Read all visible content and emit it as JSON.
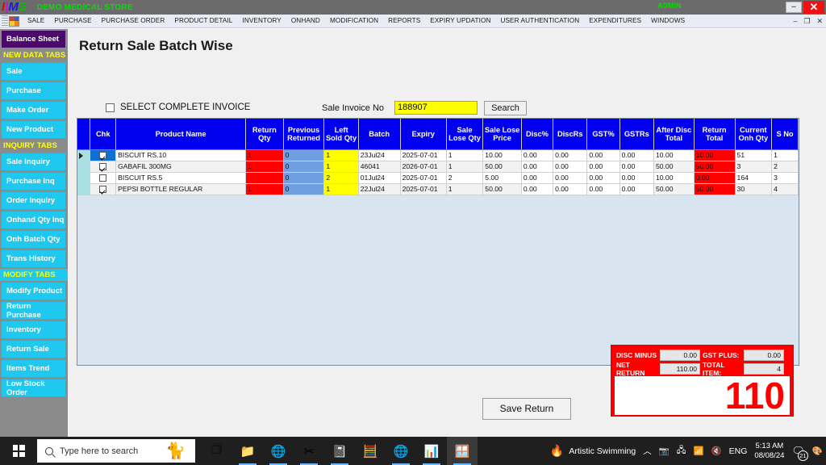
{
  "titlebar": {
    "logo_letters": [
      "I",
      "M",
      "S"
    ],
    "store_name": "DEMO MEDICAL STORE",
    "user_role": "ADMIN",
    "minimize_label": "–",
    "close_label": "✕"
  },
  "menubar": {
    "items": [
      "SALE",
      "PURCHASE",
      "PURCHASE ORDER",
      "PRODUCT DETAIL",
      "INVENTORY",
      "ONHAND",
      "MODIFICATION",
      "REPORTS",
      "EXPIRY UPDATION",
      "USER AUTHENTICATION",
      "EXPENDITURES",
      "WINDOWS"
    ],
    "mdi_minimize": "–",
    "mdi_restore": "❐",
    "mdi_close": "✕"
  },
  "sidebar": {
    "items": [
      {
        "label": "Balance Sheet",
        "type": "balance"
      },
      {
        "label": "NEW DATA TABS",
        "type": "header"
      },
      {
        "label": "Sale",
        "type": "button"
      },
      {
        "label": "Purchase",
        "type": "button"
      },
      {
        "label": "Make Order",
        "type": "button"
      },
      {
        "label": "New Product",
        "type": "button"
      },
      {
        "label": "INQUIRY TABS",
        "type": "header"
      },
      {
        "label": "Sale Inquiry",
        "type": "button"
      },
      {
        "label": "Purchase Inq",
        "type": "button"
      },
      {
        "label": "Order Inquiry",
        "type": "button"
      },
      {
        "label": "Onhand Qty Inq",
        "type": "button"
      },
      {
        "label": "Onh Batch Qty",
        "type": "button"
      },
      {
        "label": "Trans History",
        "type": "button"
      },
      {
        "label": "MODIFY TABS",
        "type": "header-modify"
      },
      {
        "label": "Modify Product",
        "type": "button"
      },
      {
        "label": "Return Purchase",
        "type": "button"
      },
      {
        "label": "Inventory",
        "type": "button"
      },
      {
        "label": "Return Sale",
        "type": "button"
      },
      {
        "label": "Items Trend",
        "type": "button"
      },
      {
        "label": "Low Stock Order",
        "type": "button"
      }
    ]
  },
  "main": {
    "page_title": "Return Sale Batch Wise",
    "select_complete_invoice_label": "SELECT COMPLETE INVOICE",
    "select_complete_invoice_checked": false,
    "invoice_label": "Sale Invoice No",
    "invoice_value": "188907",
    "search_button": "Search",
    "save_button": "Save Return"
  },
  "grid": {
    "columns": [
      "",
      "Chk",
      "Product Name",
      "Return Qty",
      "Previous Returned",
      "Left Sold Qty",
      "Batch",
      "Expiry",
      "Sale Lose Qty",
      "Sale Lose Price",
      "Disc%",
      "DiscRs",
      "GST%",
      "GSTRs",
      "After Disc Total",
      "Return Total",
      "Current Onh Qty",
      "S No"
    ],
    "rows": [
      {
        "selected": true,
        "checked": true,
        "product_name": "BISCUIT RS.10",
        "return_qty": "1",
        "previous_returned": "0",
        "left_sold_qty": "1",
        "batch": "23Jul24",
        "expiry": "2025-07-01",
        "sale_lose_qty": "1",
        "sale_lose_price": "10.00",
        "disc_pct": "0.00",
        "disc_rs": "0.00",
        "gst_pct": "0.00",
        "gst_rs": "0.00",
        "after_disc_total": "10.00",
        "return_total": "10.00",
        "current_onh_qty": "51",
        "s_no": "1"
      },
      {
        "selected": false,
        "checked": true,
        "product_name": "GABAFIL 300MG",
        "return_qty": "1",
        "previous_returned": "0",
        "left_sold_qty": "1",
        "batch": "46041",
        "expiry": "2026-07-01",
        "sale_lose_qty": "1",
        "sale_lose_price": "50.00",
        "disc_pct": "0.00",
        "disc_rs": "0.00",
        "gst_pct": "0.00",
        "gst_rs": "0.00",
        "after_disc_total": "50.00",
        "return_total": "50.00",
        "current_onh_qty": "3",
        "s_no": "2"
      },
      {
        "selected": false,
        "checked": false,
        "product_name": "BISCUIT RS.5",
        "return_qty": "",
        "previous_returned": "0",
        "left_sold_qty": "2",
        "batch": "01Jul24",
        "expiry": "2025-07-01",
        "sale_lose_qty": "2",
        "sale_lose_price": "5.00",
        "disc_pct": "0.00",
        "disc_rs": "0.00",
        "gst_pct": "0.00",
        "gst_rs": "0.00",
        "after_disc_total": "10.00",
        "return_total": "0.00",
        "current_onh_qty": "164",
        "s_no": "3"
      },
      {
        "selected": false,
        "checked": true,
        "product_name": "PEPSI BOTTLE REGULAR",
        "return_qty": "1",
        "previous_returned": "0",
        "left_sold_qty": "1",
        "batch": "22Jul24",
        "expiry": "2025-07-01",
        "sale_lose_qty": "1",
        "sale_lose_price": "50.00",
        "disc_pct": "0.00",
        "disc_rs": "0.00",
        "gst_pct": "0.00",
        "gst_rs": "0.00",
        "after_disc_total": "50.00",
        "return_total": "50.00",
        "current_onh_qty": "30",
        "s_no": "4"
      }
    ]
  },
  "totals": {
    "disc_minus_label": "DISC MINUS",
    "disc_minus_value": "0.00",
    "gst_plus_label": "GST PLUS:",
    "gst_plus_value": "0.00",
    "net_return_label": "NET RETURN",
    "net_return_value": "110.00",
    "total_item_label": "TOTAL ITEM:",
    "total_item_value": "4",
    "grand_total": "110"
  },
  "taskbar": {
    "search_placeholder": "Type here to search",
    "news_text": "Artistic Swimming",
    "language": "ENG",
    "time": "5:13 AM",
    "date": "08/08/24",
    "notification_count": "21"
  },
  "colors": {
    "header_blue": "#0000ee",
    "sidebar_cyan": "#1ec8ef",
    "balance_purple": "#4b0a6b",
    "accent_red": "#ff0000",
    "accent_yellow": "#ffff00"
  }
}
